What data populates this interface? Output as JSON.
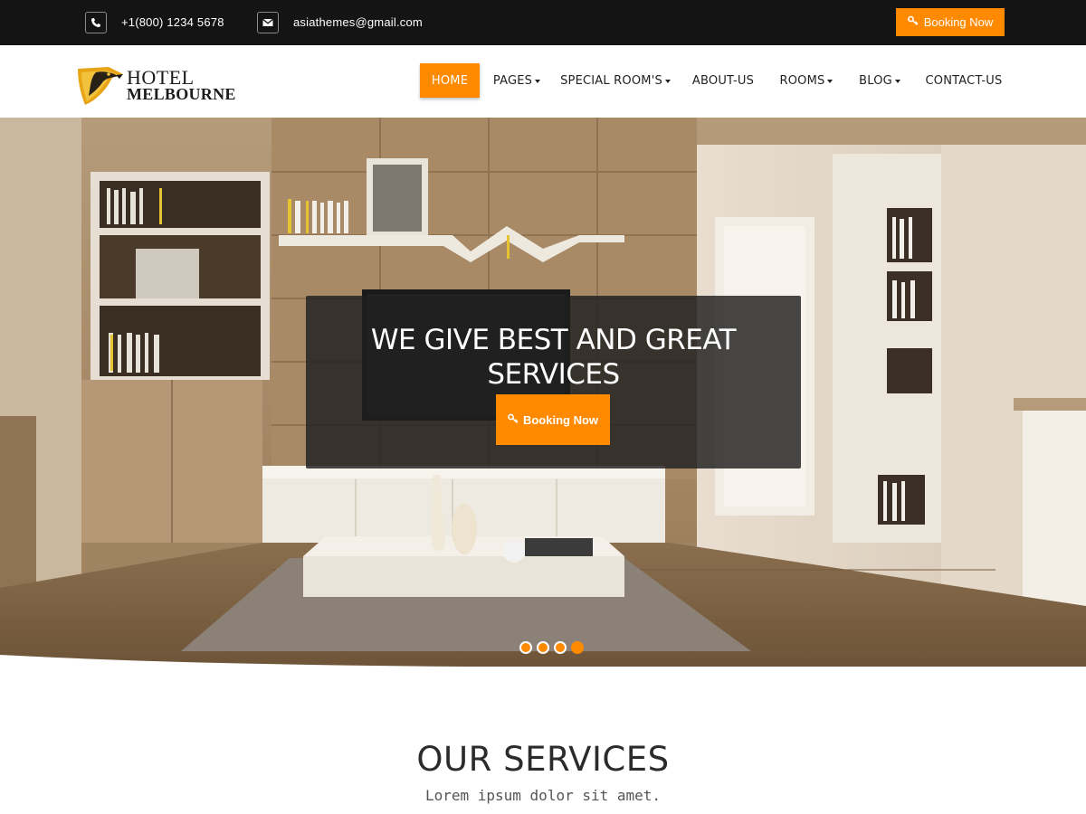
{
  "topbar": {
    "phone": "+1(800) 1234 5678",
    "email": "asiathemes@gmail.com",
    "booking_label": "Booking Now",
    "phone_icon": "phone-icon",
    "email_icon": "envelope-icon",
    "booking_icon": "key-icon"
  },
  "logo": {
    "line1": "HOTEL",
    "line2": "MELBOURNE",
    "icon": "eagle-icon"
  },
  "nav": {
    "items": [
      {
        "label": "HOME",
        "active": true,
        "dropdown": false
      },
      {
        "label": "PAGES",
        "active": false,
        "dropdown": true
      },
      {
        "label": "SPECIAL ROOM'S",
        "active": false,
        "dropdown": true
      },
      {
        "label": "ABOUT-US",
        "active": false,
        "dropdown": false
      },
      {
        "label": "ROOMS",
        "active": false,
        "dropdown": true
      },
      {
        "label": "BLOG",
        "active": false,
        "dropdown": true
      },
      {
        "label": "CONTACT-US",
        "active": false,
        "dropdown": false
      }
    ]
  },
  "hero": {
    "title_line1": "WE GIVE BEST AND GREAT",
    "title_line2": "SERVICES",
    "booking_label": "Booking Now",
    "slides": 4,
    "active_slide": 4
  },
  "services": {
    "title": "OUR SERVICES",
    "subtitle": "Lorem ipsum dolor sit amet."
  },
  "colors": {
    "accent": "#ff8a00",
    "topbar": "#141414",
    "text_dark": "#2b2b2b"
  }
}
